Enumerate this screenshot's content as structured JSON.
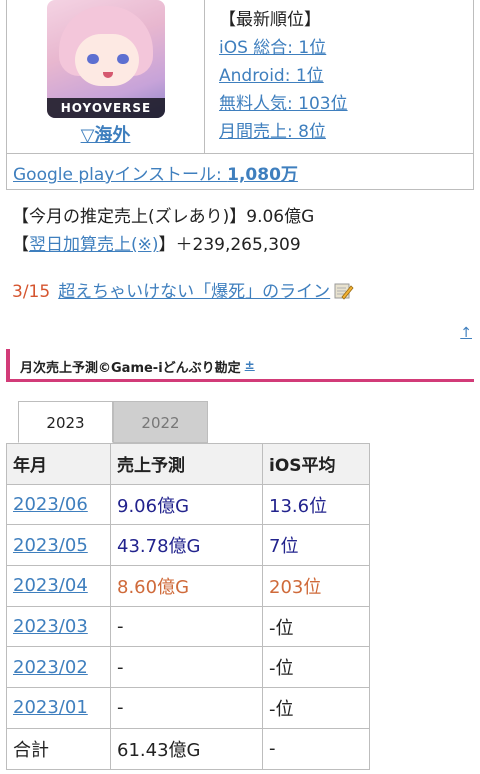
{
  "app": {
    "logo_text": "HOYOVERSE",
    "region_link": "▽海外"
  },
  "ranking": {
    "title": "【最新順位】",
    "items": [
      "iOS 総合: 1位",
      "Android: 1位",
      "無料人気: 103位",
      "月間売上: 8位"
    ]
  },
  "install": {
    "label": "Google playインストール: ",
    "value": "1,080万"
  },
  "revenue": {
    "monthly_estimate": "【今月の推定売上(ズレあり)】9.06億G",
    "next_day_prefix": "【",
    "next_day_link": "翌日加算売上(※)",
    "next_day_suffix": "】＋239,265,309"
  },
  "notice": {
    "date": "3/15",
    "link": "超えちゃいけない「爆死」のライン"
  },
  "section": {
    "title": "月次売上予測©Game-iどんぶり勘定",
    "sup": "±",
    "top_arrow": "↑"
  },
  "tabs": [
    "2023",
    "2022"
  ],
  "table": {
    "headers": [
      "年月",
      "売上予測",
      "iOS平均"
    ],
    "rows": [
      {
        "month": "2023/06",
        "revenue": "9.06億G",
        "ios": "13.6位",
        "color": "navy"
      },
      {
        "month": "2023/05",
        "revenue": "43.78億G",
        "ios": "7位",
        "color": "navy"
      },
      {
        "month": "2023/04",
        "revenue": "8.60億G",
        "ios": "203位",
        "color": "orange"
      },
      {
        "month": "2023/03",
        "revenue": "-",
        "ios": "-位",
        "color": "plain"
      },
      {
        "month": "2023/02",
        "revenue": "-",
        "ios": "-位",
        "color": "plain"
      },
      {
        "month": "2023/01",
        "revenue": "-",
        "ios": "-位",
        "color": "plain"
      }
    ],
    "total_label": "合計",
    "total_revenue": "61.43億G",
    "total_ios": "-"
  },
  "colors": {
    "link": "#3f7fbe",
    "accent": "#d23b78",
    "navy": "#22238d",
    "orange": "#cf6a3a",
    "date": "#d5552f"
  }
}
